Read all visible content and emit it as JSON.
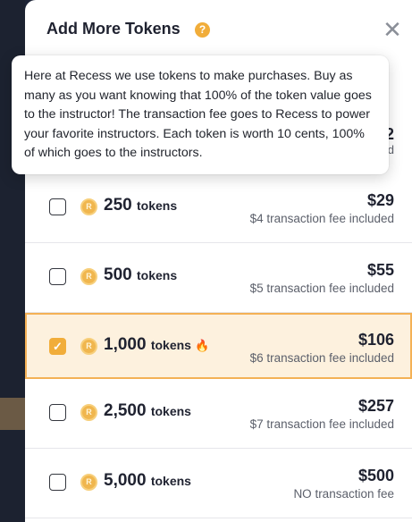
{
  "modal": {
    "title": "Add More Tokens",
    "help_icon": "question-circle-icon",
    "close_icon": "close-x-icon"
  },
  "tooltip": {
    "text": "Here at Recess we use tokens to make purchases. Buy as many as you want knowing that 100% of the token value goes to the instructor! The transaction fee goes to Recess to power your favorite instructors. Each token is worth 10 cents, 100% of which goes to the instructors."
  },
  "partially_hidden_row": {
    "price_fragment": "2",
    "fee_fragment": "d"
  },
  "packages": [
    {
      "amount": "250",
      "unit": "tokens",
      "price": "$29",
      "fee": "$4 transaction fee included",
      "selected": false,
      "badge": ""
    },
    {
      "amount": "500",
      "unit": "tokens",
      "price": "$55",
      "fee": "$5 transaction fee included",
      "selected": false,
      "badge": ""
    },
    {
      "amount": "1,000",
      "unit": "tokens",
      "price": "$106",
      "fee": "$6 transaction fee included",
      "selected": true,
      "badge": "fire-icon"
    },
    {
      "amount": "2,500",
      "unit": "tokens",
      "price": "$257",
      "fee": "$7 transaction fee included",
      "selected": false,
      "badge": ""
    },
    {
      "amount": "5,000",
      "unit": "tokens",
      "price": "$500",
      "fee": "NO transaction fee",
      "selected": false,
      "badge": ""
    }
  ],
  "colors": {
    "accent": "#f1ad3a",
    "selected_bg": "#fdf1de",
    "selected_border": "#f4b155"
  }
}
